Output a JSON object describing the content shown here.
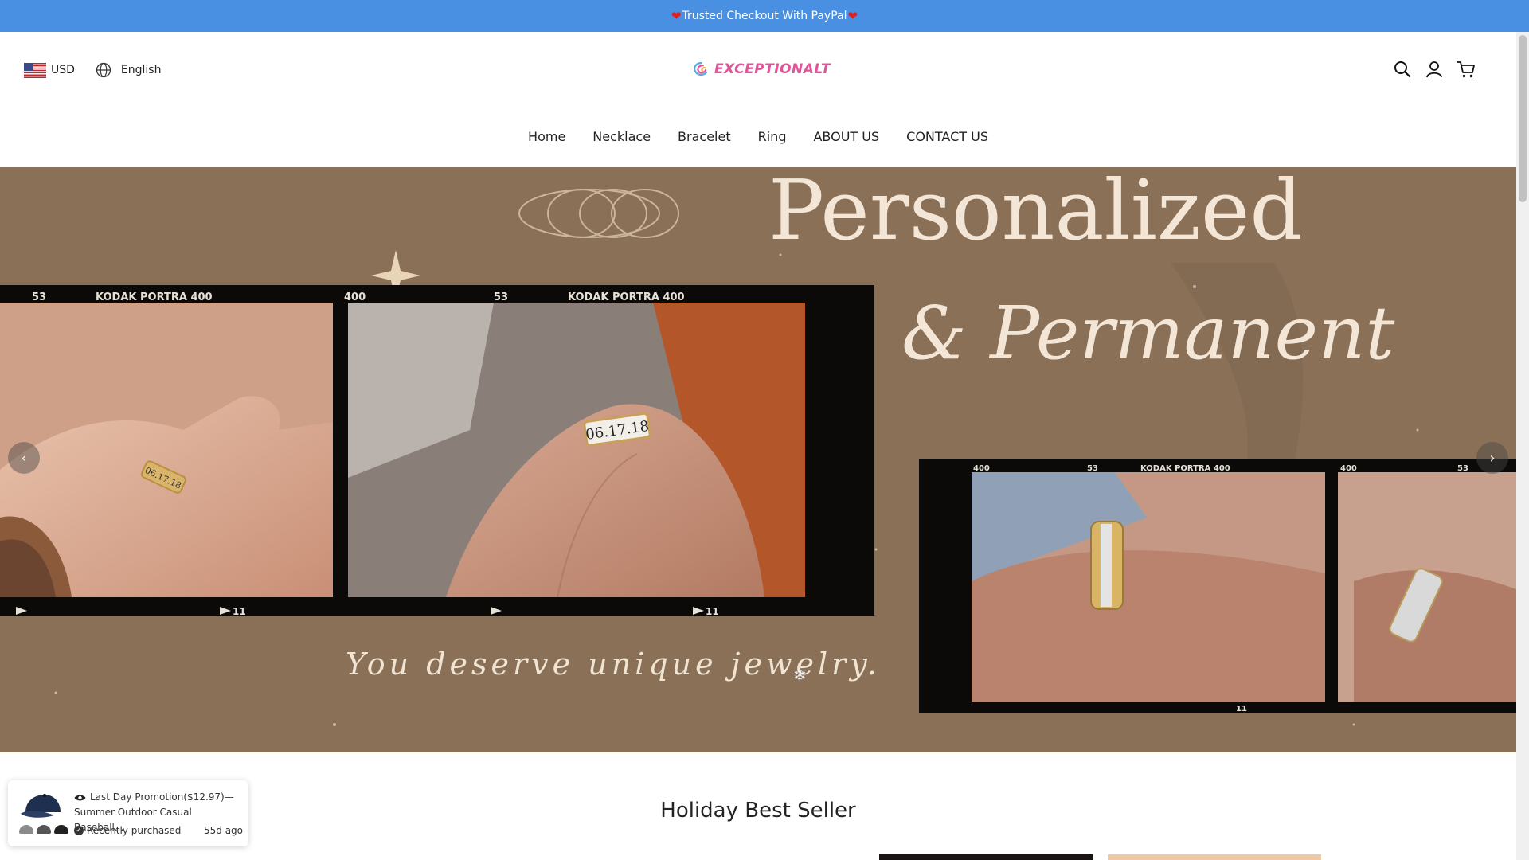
{
  "announcement": {
    "text": "Trusted Checkout With PayPal",
    "heart": "❤"
  },
  "header": {
    "currency": "USD",
    "language": "English",
    "logo_text": "EXCEPTIONALT",
    "icons": [
      "search-icon",
      "account-icon",
      "cart-icon"
    ]
  },
  "nav": {
    "items": [
      {
        "label": "Home"
      },
      {
        "label": "Necklace"
      },
      {
        "label": "Bracelet"
      },
      {
        "label": "Ring"
      },
      {
        "label": "ABOUT US"
      },
      {
        "label": "CONTACT US"
      }
    ]
  },
  "hero": {
    "headline_1": "Personalized",
    "headline_2": "& Permanent",
    "tagline": "You deserve unique jewelry.",
    "film_brand": "KODAK PORTRA 400",
    "film_numbers": [
      "53",
      "400",
      "11"
    ],
    "ring_engraving": "06.17.18",
    "prev_label": "‹",
    "next_label": "›"
  },
  "section": {
    "title": "Holiday Best Seller"
  },
  "popup": {
    "title": "Last Day Promotion($12.97)—Summer Outdoor Casual Baseball...",
    "status": "Recently purchased",
    "time_ago": "55d ago"
  },
  "colors": {
    "announcement_bg": "#4a90e2",
    "hero_bg": "#8a7057",
    "logo": "#e0559a",
    "headline": "#f4e6d6"
  }
}
